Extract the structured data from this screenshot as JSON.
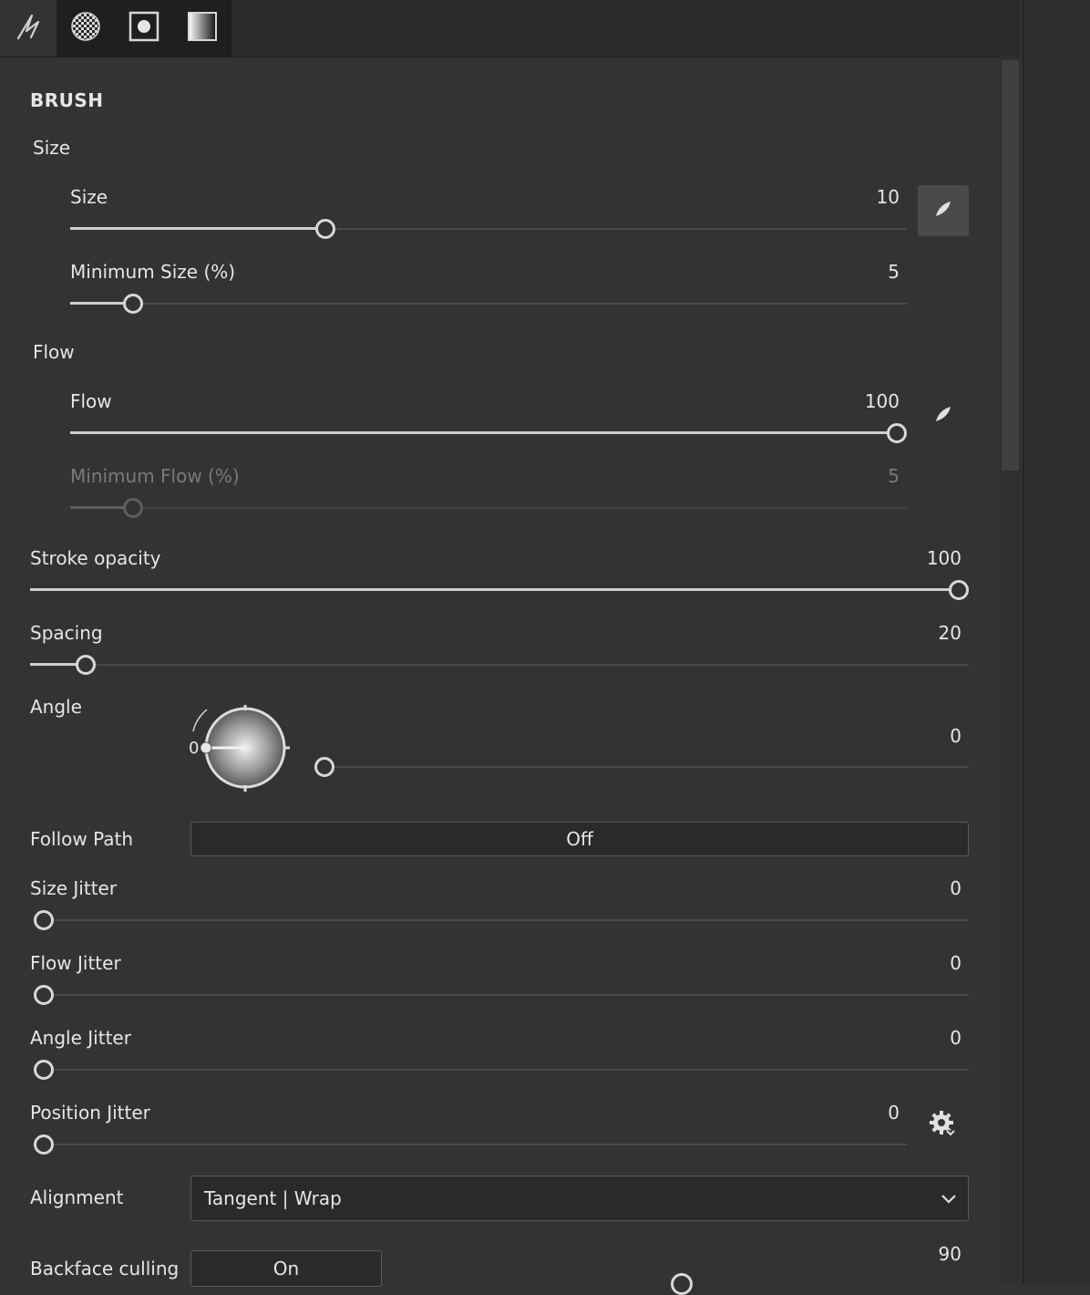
{
  "tabs": [
    {
      "icon": "brush-stroke-icon"
    },
    {
      "icon": "checker-pattern-icon"
    },
    {
      "icon": "square-dot-icon"
    },
    {
      "icon": "gradient-square-icon"
    }
  ],
  "section_title": "BRUSH",
  "size_group": {
    "label": "Size",
    "size": {
      "label": "Size",
      "value": "10",
      "fraction": 0.3
    },
    "min_size": {
      "label": "Minimum Size (%)",
      "value": "5",
      "fraction": 0.065
    }
  },
  "flow_group": {
    "label": "Flow",
    "flow": {
      "label": "Flow",
      "value": "100",
      "fraction": 1.0
    },
    "min_flow": {
      "label": "Minimum Flow (%)",
      "value": "5",
      "fraction": 0.065,
      "disabled": true
    }
  },
  "stroke_opacity": {
    "label": "Stroke opacity",
    "value": "100",
    "fraction": 1.0
  },
  "spacing": {
    "label": "Spacing",
    "value": "20",
    "fraction": 0.05
  },
  "angle": {
    "label": "Angle",
    "value": "0",
    "dial_label": "0",
    "fraction": 0.0
  },
  "follow_path": {
    "label": "Follow Path",
    "value": "Off"
  },
  "size_jitter": {
    "label": "Size Jitter",
    "value": "0",
    "fraction": 0.0
  },
  "flow_jitter": {
    "label": "Flow Jitter",
    "value": "0",
    "fraction": 0.0
  },
  "angle_jitter": {
    "label": "Angle Jitter",
    "value": "0",
    "fraction": 0.0
  },
  "position_jitter": {
    "label": "Position Jitter",
    "value": "0",
    "fraction": 0.0
  },
  "alignment": {
    "label": "Alignment",
    "value": "Tangent | Wrap"
  },
  "backface_culling": {
    "label": "Backface culling",
    "value": "On",
    "threshold": "90"
  }
}
